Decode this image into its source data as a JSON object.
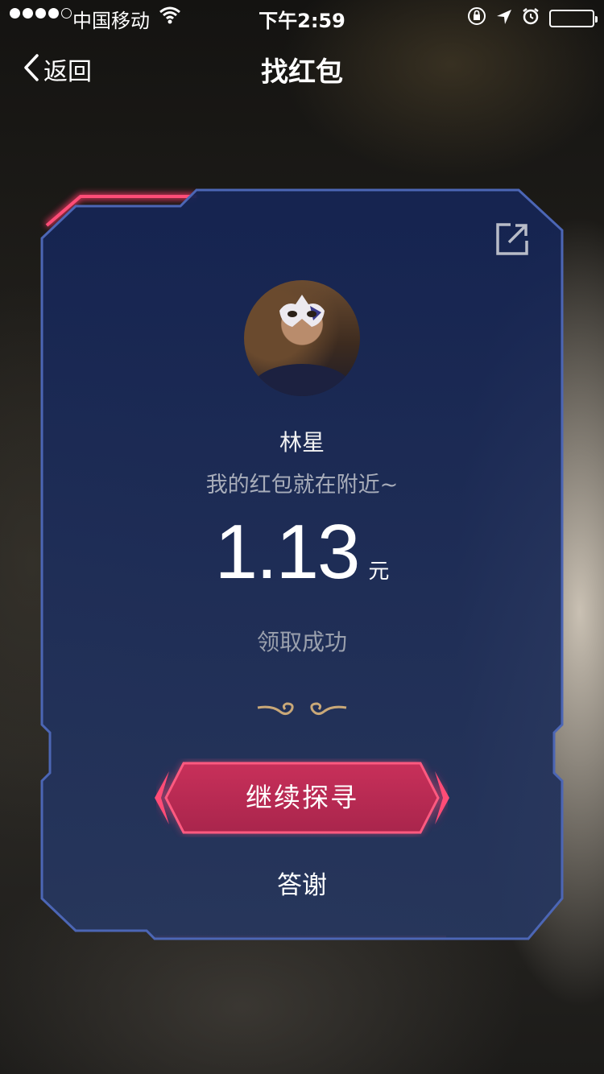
{
  "status_bar": {
    "carrier": "中国移动",
    "time": "下午2:59",
    "signal_bars": 4,
    "signal_total": 5,
    "icons": [
      "wifi-icon",
      "orientation-lock-icon",
      "location-arrow-icon",
      "alarm-icon",
      "battery-icon"
    ],
    "battery_level": 1.0
  },
  "nav": {
    "back_label": "返回",
    "title": "找红包"
  },
  "card": {
    "user_name": "林星",
    "greeting": "我的红包就在附近~",
    "amount": "1.13",
    "unit": "元",
    "status": "领取成功",
    "primary_button": "继续探寻",
    "secondary_button": "答谢",
    "share_icon": "share-out-icon"
  },
  "colors": {
    "card_fill": "#1f2d55",
    "card_border": "#4c66b5",
    "accent_red": "#e8365f",
    "divider_gold": "#c9a878"
  }
}
